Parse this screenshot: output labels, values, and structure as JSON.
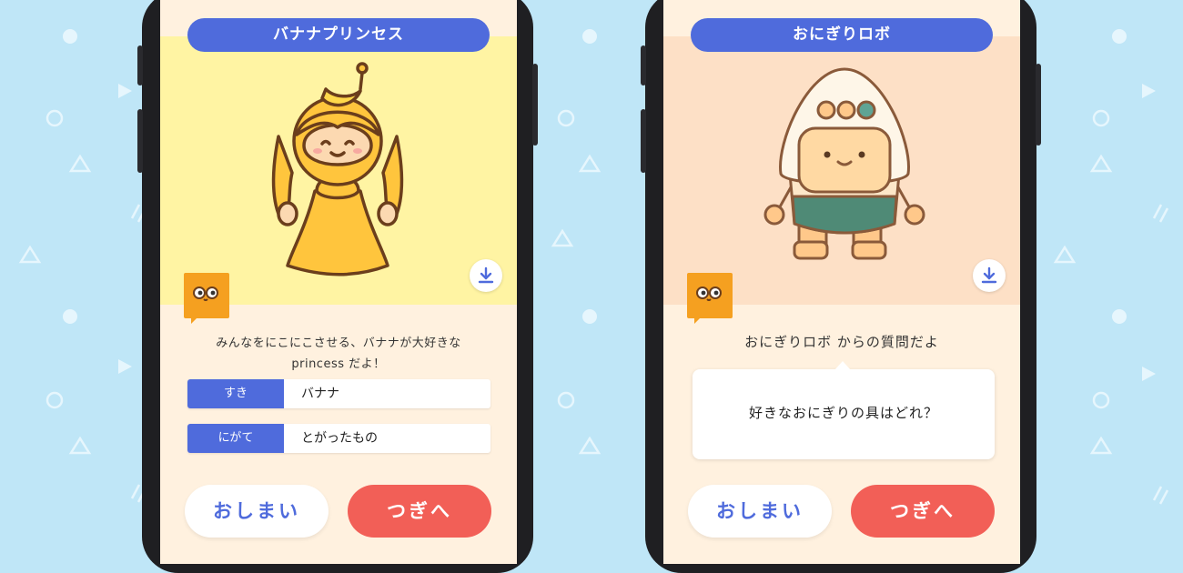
{
  "colors": {
    "background": "#bfe6f7",
    "accent_blue": "#4f6bdc",
    "next_red": "#f25f57",
    "screen_cream": "#fff1df",
    "hero_yellow": "#fff4a3",
    "hero_peach": "#fde0c6",
    "mascot_orange": "#f5a020"
  },
  "left_card": {
    "title": "バナナプリンセス",
    "description_line1": "みんなをにこにこさせる、バナナが大好きな",
    "description_line2": "princess だよ！",
    "attributes": [
      {
        "label": "すき",
        "value": "バナナ"
      },
      {
        "label": "にがて",
        "value": "とがったもの"
      }
    ],
    "end_button": "おしまい",
    "next_button": "つぎへ",
    "download_icon": "download-icon",
    "mascot_icon": "owl-mascot-icon"
  },
  "right_card": {
    "title": "おにぎりロボ",
    "question_intro": "おにぎりロボ からの質問だよ",
    "question": "好きなおにぎりの具はどれ？",
    "end_button": "おしまい",
    "next_button": "つぎへ",
    "download_icon": "download-icon",
    "mascot_icon": "owl-mascot-icon"
  }
}
